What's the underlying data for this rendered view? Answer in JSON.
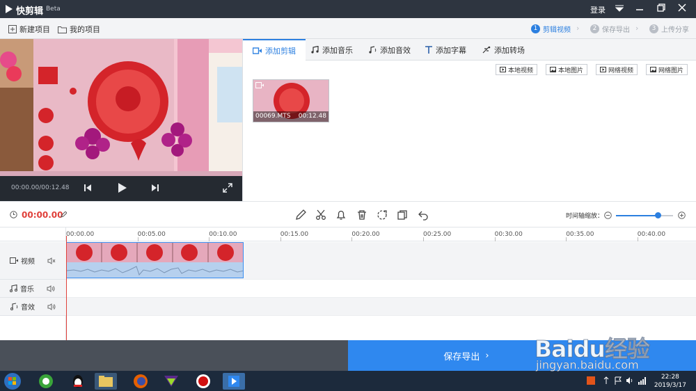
{
  "titlebar": {
    "app_name": "快剪辑",
    "beta": "Beta",
    "login": "登录"
  },
  "toolbar": {
    "new_project": "新建项目",
    "my_projects": "我的项目",
    "steps": [
      {
        "num": "1",
        "label": "剪辑视频",
        "active": true
      },
      {
        "num": "2",
        "label": "保存导出",
        "active": false
      },
      {
        "num": "3",
        "label": "上传分享",
        "active": false
      }
    ]
  },
  "preview": {
    "time": "00:00.00/00:12.48"
  },
  "tabs": [
    {
      "label": "添加剪辑",
      "icon": "video-icon",
      "active": true
    },
    {
      "label": "添加音乐",
      "icon": "music-icon",
      "active": false
    },
    {
      "label": "添加音效",
      "icon": "sound-effect-icon",
      "active": false
    },
    {
      "label": "添加字幕",
      "icon": "text-icon",
      "active": false
    },
    {
      "label": "添加转场",
      "icon": "transition-icon",
      "active": false
    }
  ],
  "source_buttons": [
    "本地视频",
    "本地图片",
    "网络视频",
    "网络图片"
  ],
  "media_clip": {
    "name": "00069.MTS",
    "duration": "00:12.48"
  },
  "edit_bar": {
    "current_time": "00:00.00",
    "tools": [
      "edit-icon",
      "cut-icon",
      "bell-icon",
      "delete-icon",
      "crop-icon",
      "copy-icon",
      "undo-icon"
    ],
    "zoom_label": "时间轴缩放：",
    "zoom_level": 0.73
  },
  "timeline": {
    "ticks": [
      "00:00.00",
      "00:05.00",
      "00:10.00",
      "00:15.00",
      "00:20.00",
      "00:25.00",
      "00:30.00",
      "00:35.00",
      "00:40.00"
    ],
    "tracks": [
      {
        "label": "视频",
        "icon": "video-icon",
        "audio_icon": "mute-icon"
      },
      {
        "label": "音乐",
        "icon": "music-icon",
        "audio_icon": "volume-icon"
      },
      {
        "label": "音效",
        "icon": "sound-effect-icon",
        "audio_icon": "volume-icon"
      }
    ]
  },
  "export": {
    "label": "保存导出"
  },
  "taskbar": {
    "time": "22:28",
    "date": "2019/3/17"
  },
  "watermark": {
    "big": "Baidu经验",
    "small": "jingyan.baidu.com"
  },
  "colors": {
    "accent": "#2b7fe0",
    "titlebar": "#2e3540",
    "export": "#2f88ef",
    "playhead": "#e0403a"
  }
}
